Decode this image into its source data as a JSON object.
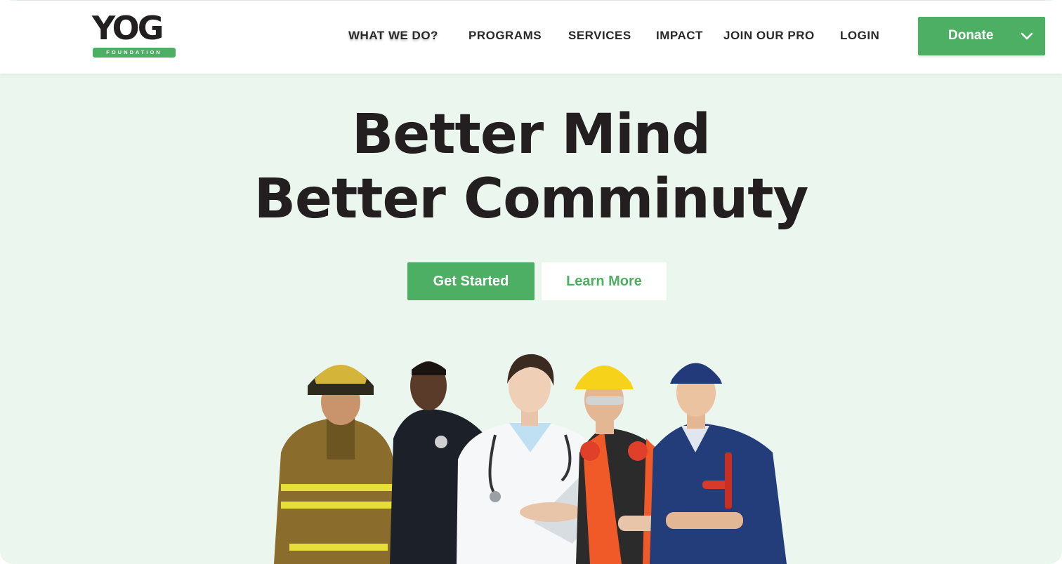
{
  "header": {
    "logo": {
      "word": "YOG",
      "tagline": "FOUNDATION"
    },
    "nav": [
      {
        "label": "WHAT WE DO?"
      },
      {
        "label": "PROGRAMS"
      },
      {
        "label": "SERVICES"
      },
      {
        "label": "IMPACT"
      },
      {
        "label": "JOIN OUR PRO"
      },
      {
        "label": "LOGIN"
      }
    ],
    "donate": {
      "label": "Donate",
      "icon": "chevron-down-icon"
    }
  },
  "hero": {
    "title_line1": "Better Mind",
    "title_line2": "Better Comminuty",
    "primary_button": "Get Started",
    "secondary_button": "Learn More",
    "image": "group of workers: firefighter, police officer, doctor, construction worker, mechanic"
  },
  "colors": {
    "brand_green": "#4caf63",
    "hero_background": "#eaf6ee",
    "text_dark": "#231f20"
  }
}
